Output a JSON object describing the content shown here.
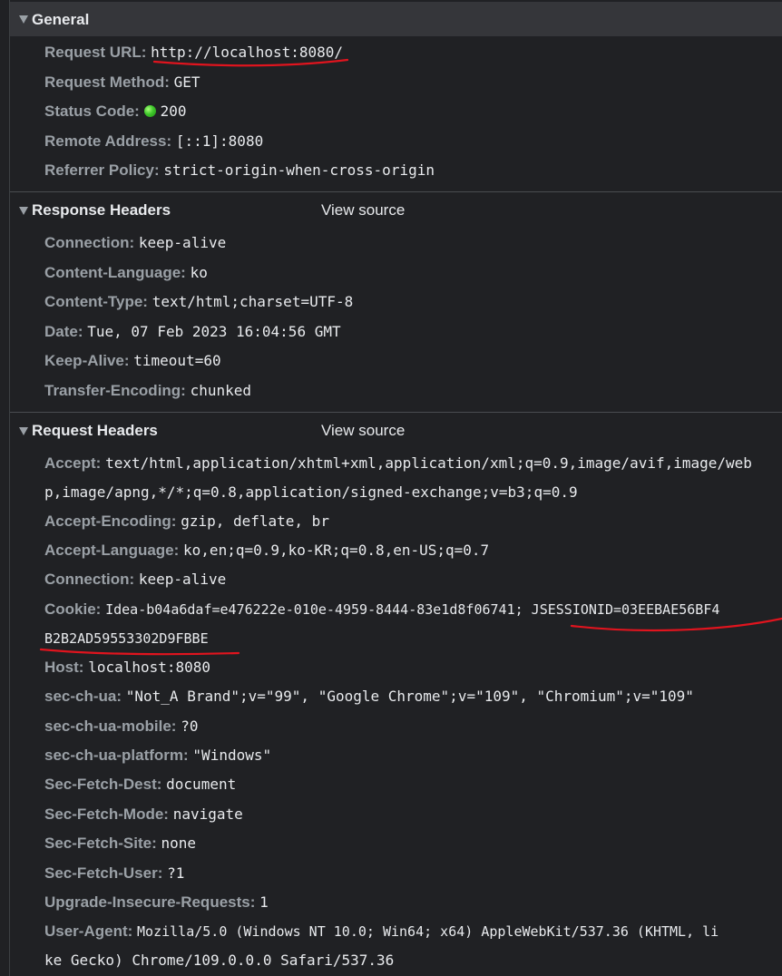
{
  "general": {
    "title": "General",
    "rows": [
      {
        "name": "Request URL:",
        "value": "http://localhost:8080/"
      },
      {
        "name": "Request Method:",
        "value": "GET"
      },
      {
        "name": "Status Code:",
        "value": "200",
        "status_color": "#3fc72b"
      },
      {
        "name": "Remote Address:",
        "value": "[::1]:8080"
      },
      {
        "name": "Referrer Policy:",
        "value": "strict-origin-when-cross-origin"
      }
    ]
  },
  "response_headers": {
    "title": "Response Headers",
    "view_source": "View source",
    "rows": [
      {
        "name": "Connection:",
        "value": "keep-alive"
      },
      {
        "name": "Content-Language:",
        "value": "ko"
      },
      {
        "name": "Content-Type:",
        "value": "text/html;charset=UTF-8"
      },
      {
        "name": "Date:",
        "value": "Tue, 07 Feb 2023 16:04:56 GMT"
      },
      {
        "name": "Keep-Alive:",
        "value": "timeout=60"
      },
      {
        "name": "Transfer-Encoding:",
        "value": "chunked"
      }
    ]
  },
  "request_headers": {
    "title": "Request Headers",
    "view_source": "View source",
    "accept": {
      "name": "Accept:",
      "value_line1": "text/html,application/xhtml+xml,application/xml;q=0.9,image/avif,image/web",
      "value_line2": "p,image/apng,*/*;q=0.8,application/signed-exchange;v=b3;q=0.9"
    },
    "accept_encoding": {
      "name": "Accept-Encoding:",
      "value": "gzip, deflate, br"
    },
    "accept_language": {
      "name": "Accept-Language:",
      "value": "ko,en;q=0.9,ko-KR;q=0.8,en-US;q=0.7"
    },
    "connection": {
      "name": "Connection:",
      "value": "keep-alive"
    },
    "cookie": {
      "name": "Cookie:",
      "value_line1": "Idea-b04a6daf=e476222e-010e-4959-8444-83e1d8f06741; JSESSIONID=03EEBAE56BF4",
      "value_line2": "B2B2AD59553302D9FBBE"
    },
    "host": {
      "name": "Host:",
      "value": "localhost:8080"
    },
    "sec_ch_ua": {
      "name": "sec-ch-ua:",
      "value": "\"Not_A Brand\";v=\"99\", \"Google Chrome\";v=\"109\", \"Chromium\";v=\"109\""
    },
    "sec_ch_ua_mobile": {
      "name": "sec-ch-ua-mobile:",
      "value": "?0"
    },
    "sec_ch_ua_platform": {
      "name": "sec-ch-ua-platform:",
      "value": "\"Windows\""
    },
    "sec_fetch_dest": {
      "name": "Sec-Fetch-Dest:",
      "value": "document"
    },
    "sec_fetch_mode": {
      "name": "Sec-Fetch-Mode:",
      "value": "navigate"
    },
    "sec_fetch_site": {
      "name": "Sec-Fetch-Site:",
      "value": "none"
    },
    "sec_fetch_user": {
      "name": "Sec-Fetch-User:",
      "value": "?1"
    },
    "upgrade_insecure": {
      "name": "Upgrade-Insecure-Requests:",
      "value": "1"
    },
    "user_agent": {
      "name": "User-Agent:",
      "value_line1": "Mozilla/5.0 (Windows NT 10.0; Win64; x64) AppleWebKit/537.36 (KHTML, li",
      "value_line2": "ke Gecko) Chrome/109.0.0.0 Safari/537.36"
    }
  },
  "annotation_color": "#e0141e"
}
